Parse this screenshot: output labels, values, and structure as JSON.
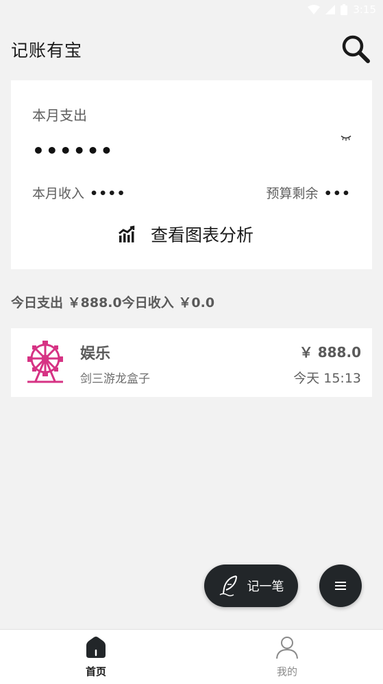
{
  "status_bar": {
    "time": "3:15"
  },
  "header": {
    "title": "记账有宝"
  },
  "summary": {
    "month_expense_label": "本月支出",
    "month_expense_value": "••••••",
    "month_income_label": "本月收入",
    "month_income_value": "••••",
    "budget_remaining_label": "预算剩余",
    "budget_remaining_value": "•••",
    "chart_analysis_label": "查看图表分析"
  },
  "daily": {
    "expense_label": "今日支出",
    "expense_value": "￥888.0",
    "income_label": "今日收入",
    "income_value": "￥0.0"
  },
  "records": [
    {
      "category": "娱乐",
      "note": "剑三游龙盒子",
      "amount": "￥ 888.0",
      "time": "今天 15:13",
      "icon": "ferris-wheel-icon",
      "icon_color": "#d63384"
    }
  ],
  "fab": {
    "record_label": "记一笔"
  },
  "nav": {
    "home_label": "首页",
    "mine_label": "我的"
  },
  "colors": {
    "fab_bg": "#222629",
    "page_bg": "#f2f2f2"
  }
}
